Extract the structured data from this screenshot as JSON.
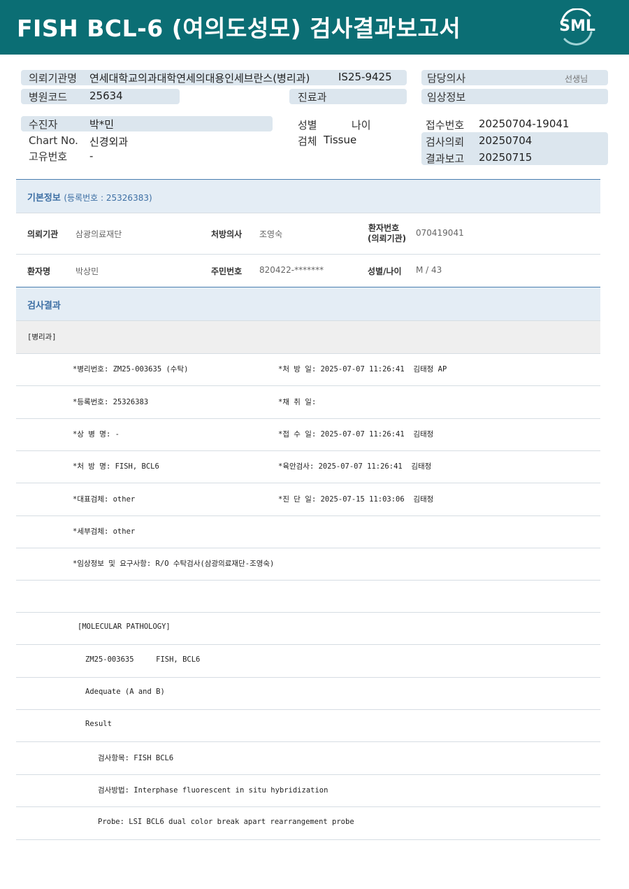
{
  "header": {
    "title": "FISH BCL-6 (여의도성모) 검사결과보고서",
    "logo_text": "SML",
    "bg_color": "#0b6e74"
  },
  "top_info": {
    "institution_label": "의뢰기관명",
    "institution_value": "연세대학교의과대학연세의대용인세브란스(병리과)",
    "institution_code": "IS25-9425",
    "doctor_label": "담당의사",
    "doctor_suffix": "선생님",
    "hospital_code_label": "병원코드",
    "hospital_code_value": "25634",
    "department_label": "진료과",
    "clinical_info_label": "임상정보",
    "patient_label": "수진자",
    "patient_value": "박*민",
    "sex_label": "성별",
    "age_label": "나이",
    "receipt_no_label": "접수번호",
    "receipt_no_value": "20250704-19041",
    "chart_label": "Chart No.",
    "chart_value": "신경외과",
    "specimen_label": "검체",
    "specimen_value": "Tissue",
    "request_label": "검사의뢰",
    "request_value": "20250704",
    "unique_label": "고유번호",
    "unique_value": "-",
    "report_label": "결과보고",
    "report_value": "20250715"
  },
  "basic_info": {
    "heading": "기본정보",
    "reg_no_text": "(등록번호 : 25326383)",
    "inst_label": "의뢰기관",
    "inst_value": "삼광의료재단",
    "prescriber_label": "처방의사",
    "prescriber_value": "조영숙",
    "patient_no_label_1": "환자번호",
    "patient_no_label_2": "(의뢰기관)",
    "patient_no_value": "070419041",
    "name_label": "환자명",
    "name_value": "박상민",
    "rrn_label": "주민번호",
    "rrn_value": "820422-*******",
    "sex_age_label": "성별/나이",
    "sex_age_value": "M / 43"
  },
  "results": {
    "heading": "검사결과",
    "dept": "[병리과]",
    "rows": [
      {
        "left": "*병리번호: ZM25-003635 (수탁)",
        "right": "*처 방 일: 2025-07-07 11:26:41  김태정 AP"
      },
      {
        "left": "*등록번호: 25326383",
        "right": "*채 취 일:"
      },
      {
        "left": "*상 병 명: -",
        "right": "*접 수 일: 2025-07-07 11:26:41  김태정"
      },
      {
        "left": "*처 방 명: FISH, BCL6",
        "right": "*육안검사: 2025-07-07 11:26:41  김태정"
      },
      {
        "left": "*대표검체: other",
        "right": "*진 단 일: 2025-07-15 11:03:06  김태정"
      },
      {
        "left": "*세부검체: other",
        "right": ""
      },
      {
        "left": "*임상정보 및 요구사항: R/O 수탁검사(삼광의료재단-조영숙)",
        "right": ""
      }
    ],
    "molecular": {
      "title": "[MOLECULAR PATHOLOGY]",
      "lines": [
        "ZM25-003635     FISH, BCL6",
        "Adequate (A and B)",
        "Result",
        "검사항목: FISH BCL6",
        "검사방법: Interphase fluorescent in situ hybridization",
        "Probe: LSI BCL6 dual color break apart rearrangement probe"
      ]
    }
  }
}
